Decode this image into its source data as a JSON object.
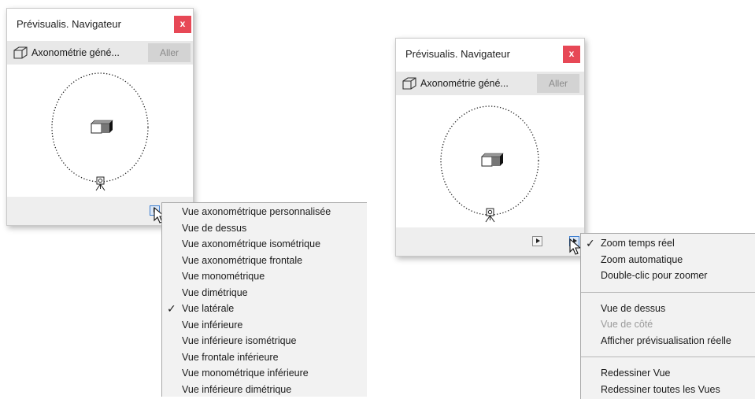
{
  "left_panel": {
    "title": "Prévisualis. Navigateur",
    "close_glyph": "x",
    "view_name": "Axonométrie géné...",
    "go_label": "Aller",
    "icons": [
      "view-box-icon",
      "camera-icon",
      "cube-icon",
      "menu-arrow-icon",
      "mouse-pointer-icon"
    ]
  },
  "right_panel": {
    "title": "Prévisualis. Navigateur",
    "close_glyph": "x",
    "view_name": "Axonométrie géné...",
    "go_label": "Aller",
    "icons": [
      "view-box-icon",
      "camera-icon",
      "cube-icon",
      "menu-arrow-icon",
      "mouse-pointer-icon"
    ]
  },
  "view_menu": {
    "check_glyph": "✓",
    "items": [
      {
        "label": "Vue axonométrique personnalisée",
        "checked": false
      },
      {
        "label": "Vue de dessus",
        "checked": false
      },
      {
        "label": "Vue axonométrique isométrique",
        "checked": false
      },
      {
        "label": "Vue axonométrique frontale",
        "checked": false
      },
      {
        "label": "Vue monométrique",
        "checked": false
      },
      {
        "label": "Vue dimétrique",
        "checked": false
      },
      {
        "label": "Vue latérale",
        "checked": true
      },
      {
        "label": "Vue inférieure",
        "checked": false
      },
      {
        "label": "Vue inférieure isométrique",
        "checked": false
      },
      {
        "label": "Vue frontale inférieure",
        "checked": false
      },
      {
        "label": "Vue monométrique inférieure",
        "checked": false
      },
      {
        "label": "Vue inférieure dimétrique",
        "checked": false
      }
    ]
  },
  "options_menu": {
    "check_glyph": "✓",
    "groups": [
      [
        {
          "label": "Zoom temps réel",
          "checked": true,
          "disabled": false
        },
        {
          "label": "Zoom automatique",
          "checked": false,
          "disabled": false
        },
        {
          "label": "Double-clic pour zoomer",
          "checked": false,
          "disabled": false
        }
      ],
      [
        {
          "label": "Vue de dessus",
          "checked": false,
          "disabled": false
        },
        {
          "label": "Vue de côté",
          "checked": false,
          "disabled": true
        },
        {
          "label": "Afficher prévisualisation réelle",
          "checked": false,
          "disabled": false
        }
      ],
      [
        {
          "label": "Redessiner Vue",
          "checked": false,
          "disabled": false
        },
        {
          "label": "Redessiner toutes les Vues",
          "checked": false,
          "disabled": false
        }
      ]
    ]
  },
  "colors": {
    "close_button": "#e74856",
    "toolbar": "#e8e8e8",
    "menu_background": "#f2f2f2",
    "active_button": "#dbe7f6"
  }
}
